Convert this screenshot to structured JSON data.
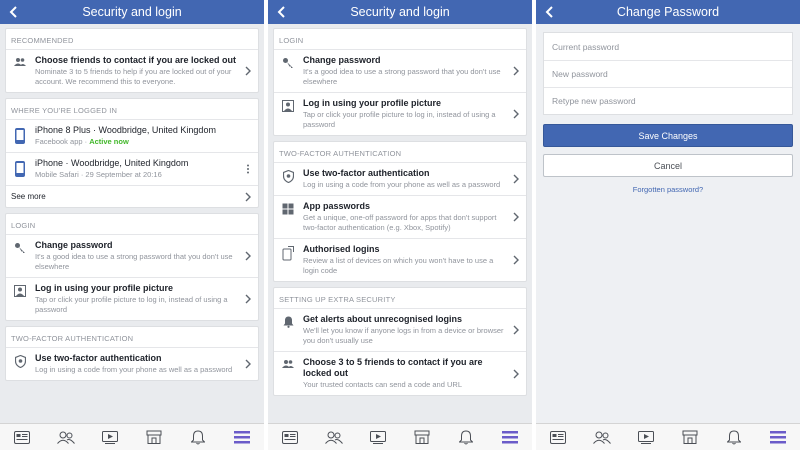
{
  "screen1": {
    "title": "Security and login",
    "recommended": {
      "label": "RECOMMENDED",
      "items": [
        {
          "title": "Choose friends to contact if you are locked out",
          "desc": "Nominate 3 to 5 friends to help if you are locked out of your account. We recommend this to everyone.",
          "icon": "friends-icon"
        }
      ]
    },
    "logged_in": {
      "label": "WHERE YOU'RE LOGGED IN",
      "devices": [
        {
          "name": "iPhone 8 Plus · Woodbridge, United Kingdom",
          "sub": "Facebook app · ",
          "active": "Active now",
          "icon": "phone-icon"
        },
        {
          "name": "iPhone · Woodbridge, United Kingdom",
          "sub": "Mobile Safari · 29 September at 20:16",
          "active": "",
          "icon": "phone-icon"
        }
      ],
      "see_more": "See more"
    },
    "login": {
      "label": "LOGIN",
      "items": [
        {
          "title": "Change password",
          "desc": "It's a good idea to use a strong password that you don't use elsewhere",
          "icon": "key-icon"
        },
        {
          "title": "Log in using your profile picture",
          "desc": "Tap or click your profile picture to log in, instead of using a password",
          "icon": "profile-picture-icon"
        }
      ]
    },
    "two_factor": {
      "label": "TWO-FACTOR AUTHENTICATION",
      "items": [
        {
          "title": "Use two-factor authentication",
          "desc": "Log in using a code from your phone as well as a password",
          "icon": "shield-icon"
        }
      ]
    }
  },
  "screen2": {
    "title": "Security and login",
    "login": {
      "label": "LOGIN",
      "items": [
        {
          "title": "Change password",
          "desc": "It's a good idea to use a strong password that you don't use elsewhere",
          "icon": "key-icon"
        },
        {
          "title": "Log in using your profile picture",
          "desc": "Tap or click your profile picture to log in, instead of using a password",
          "icon": "profile-picture-icon"
        }
      ]
    },
    "two_factor": {
      "label": "TWO-FACTOR AUTHENTICATION",
      "items": [
        {
          "title": "Use two-factor authentication",
          "desc": "Log in using a code from your phone as well as a password",
          "icon": "shield-icon"
        },
        {
          "title": "App passwords",
          "desc": "Get a unique, one-off password for apps that don't support two-factor authentication (e.g. Xbox, Spotify)",
          "icon": "app-passwords-icon"
        },
        {
          "title": "Authorised logins",
          "desc": "Review a list of devices on which you won't have to use a login code",
          "icon": "authorised-logins-icon"
        }
      ]
    },
    "extra": {
      "label": "SETTING UP EXTRA SECURITY",
      "items": [
        {
          "title": "Get alerts about unrecognised logins",
          "desc": "We'll let you know if anyone logs in from a device or browser you don't usually use",
          "icon": "bell-icon"
        },
        {
          "title": "Choose 3 to 5 friends to contact if you are locked out",
          "desc": "Your trusted contacts can send a code and URL",
          "icon": "friends-icon"
        }
      ]
    }
  },
  "screen3": {
    "title": "Change Password",
    "current_placeholder": "Current password",
    "new_placeholder": "New password",
    "retype_placeholder": "Retype new password",
    "save_label": "Save Changes",
    "cancel_label": "Cancel",
    "forgot_label": "Forgotten password?"
  },
  "tabbar": [
    "news-feed-icon",
    "friends-icon",
    "watch-icon",
    "marketplace-icon",
    "notifications-icon",
    "menu-icon"
  ],
  "colors": {
    "brand": "#4267b2",
    "active": "#42b72a",
    "menu_active": "#6b5cc9"
  }
}
